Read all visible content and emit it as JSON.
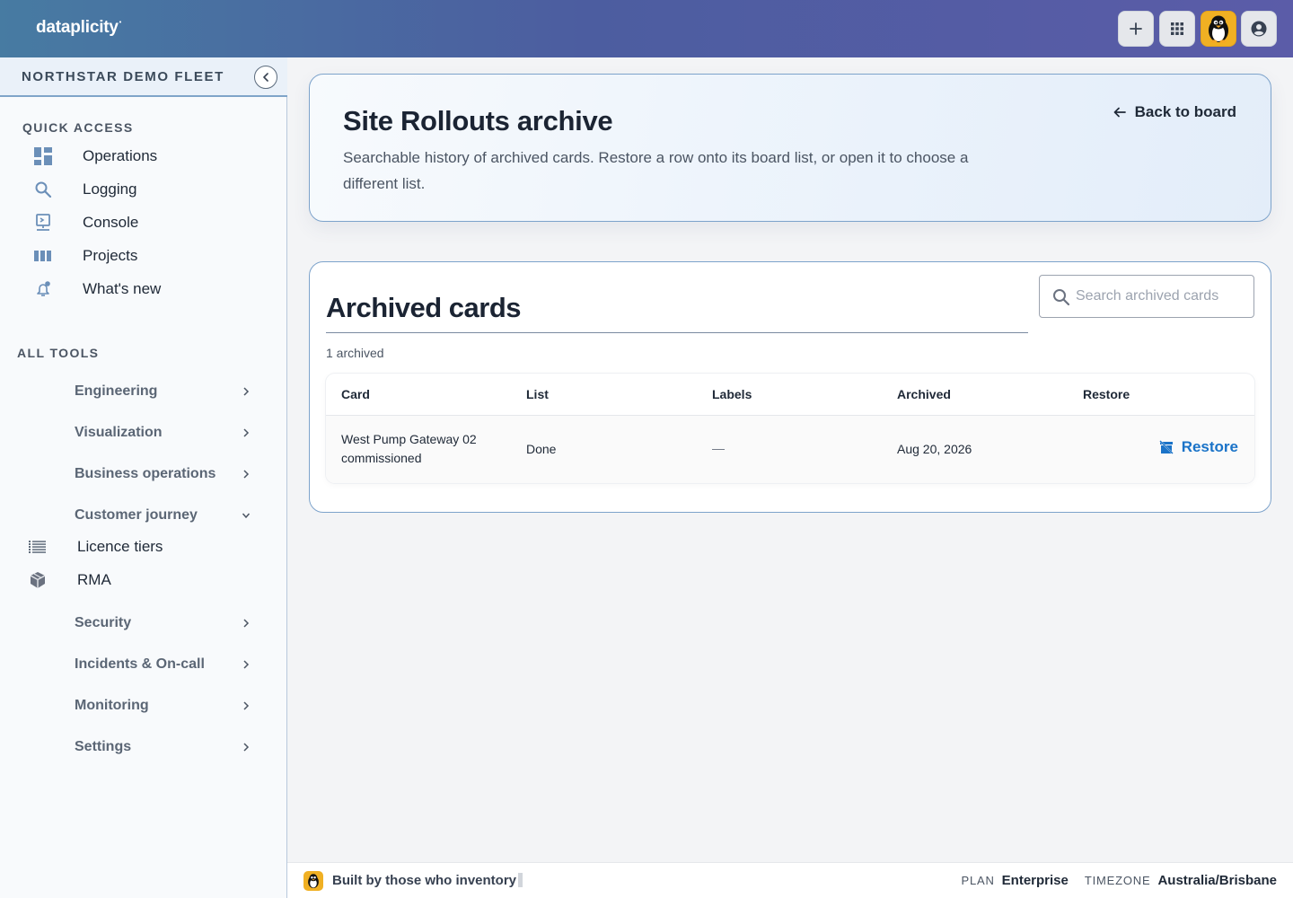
{
  "header": {
    "brand": "dataplicity",
    "brand_mark": "•"
  },
  "sidebar": {
    "fleet_name": "NORTHSTAR DEMO FLEET",
    "quick_access_title": "QUICK ACCESS",
    "quick_access": [
      {
        "label": "Operations",
        "icon": "dashboard-icon"
      },
      {
        "label": "Logging",
        "icon": "search-icon"
      },
      {
        "label": "Console",
        "icon": "terminal-icon"
      },
      {
        "label": "Projects",
        "icon": "columns-icon"
      },
      {
        "label": "What's new",
        "icon": "bell-icon"
      }
    ],
    "all_tools_title": "ALL TOOLS",
    "tools": [
      {
        "label": "Engineering",
        "expanded": false
      },
      {
        "label": "Visualization",
        "expanded": false
      },
      {
        "label": "Business operations",
        "expanded": false
      },
      {
        "label": "Customer journey",
        "expanded": true
      },
      {
        "label": "Security",
        "expanded": false
      },
      {
        "label": "Incidents & On-call",
        "expanded": false
      },
      {
        "label": "Monitoring",
        "expanded": false
      },
      {
        "label": "Settings",
        "expanded": false
      }
    ],
    "customer_journey_items": [
      {
        "label": "Licence tiers",
        "icon": "list-icon"
      },
      {
        "label": "RMA",
        "icon": "box-icon"
      }
    ]
  },
  "hero": {
    "title": "Site Rollouts archive",
    "description": "Searchable history of archived cards. Restore a row onto its board list, or open it to choose a different list.",
    "back_label": "Back to board"
  },
  "panel": {
    "title": "Archived cards",
    "search_placeholder": "Search archived cards",
    "count_label": "1 archived",
    "columns": [
      "Card",
      "List",
      "Labels",
      "Archived",
      "Restore"
    ],
    "rows": [
      {
        "card": "West Pump Gateway 02 commissioned",
        "list": "Done",
        "labels": "—",
        "archived": "Aug 20, 2026",
        "restore_label": "Restore"
      }
    ]
  },
  "footer": {
    "tagline": "Built by those who inventory",
    "plan_key": "PLAN",
    "plan_value": "Enterprise",
    "timezone_key": "TIMEZONE",
    "timezone_value": "Australia/Brisbane"
  },
  "colors": {
    "accent": "#1a73c8",
    "header_start": "#477ba2",
    "header_end": "#5b5ca8",
    "penguin_bg": "#f0b023"
  }
}
